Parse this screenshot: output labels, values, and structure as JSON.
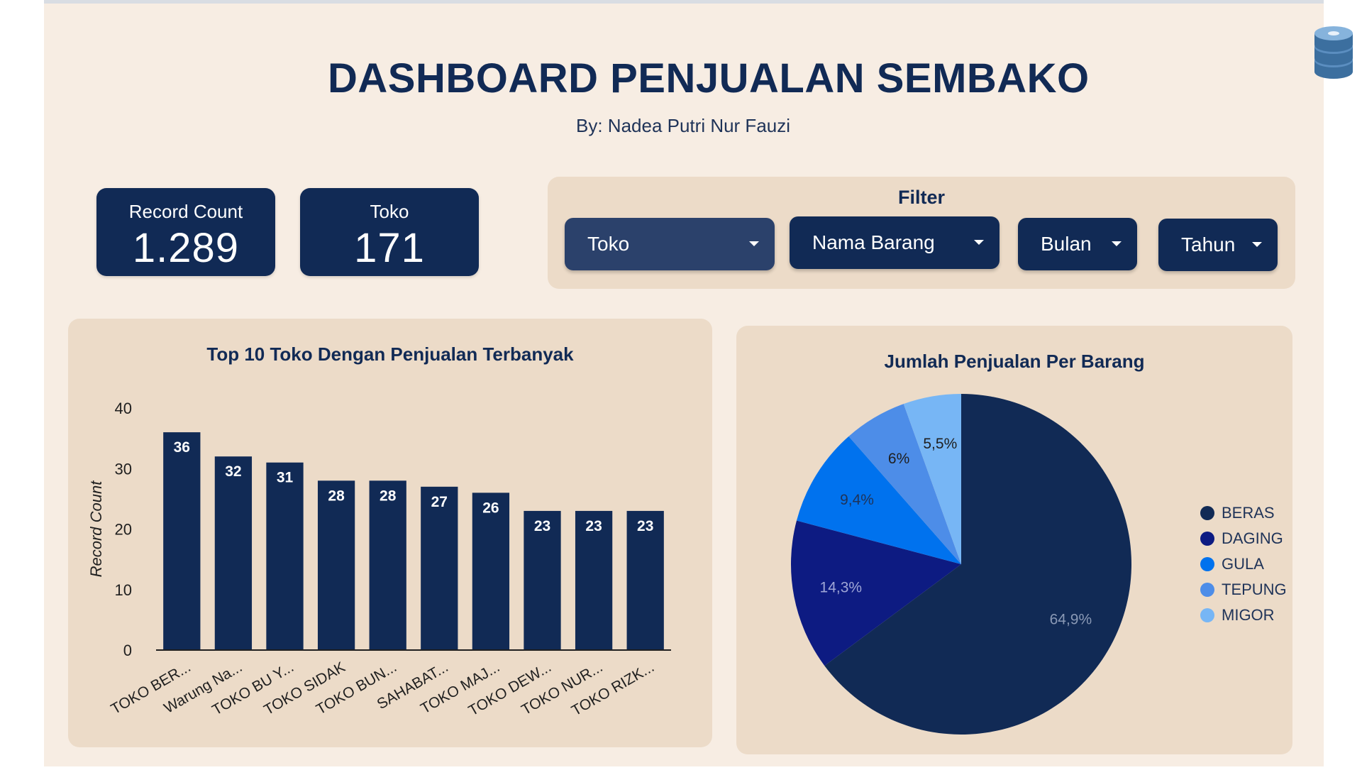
{
  "header": {
    "title": "DASHBOARD PENJUALAN SEMBAKO",
    "subtitle": "By: Nadea Putri Nur Fauzi"
  },
  "icons": {
    "data_source": "database-icon"
  },
  "kpis": [
    {
      "label": "Record Count",
      "value": "1.289"
    },
    {
      "label": "Toko",
      "value": "171"
    }
  ],
  "filter": {
    "title": "Filter",
    "dropdowns": [
      {
        "label": "Toko",
        "selected": true
      },
      {
        "label": "Nama Barang",
        "selected": false
      },
      {
        "label": "Bulan",
        "selected": false
      },
      {
        "label": "Tahun",
        "selected": false
      }
    ]
  },
  "colors": {
    "primary": "#112a55",
    "background": "#f7ede3",
    "panel": "#ecdbc8",
    "selected_dropdown": "#2b416b"
  },
  "chart_data": [
    {
      "type": "bar",
      "title": "Top 10 Toko Dengan Penjualan Terbanyak",
      "ylabel": "Record Count",
      "xlabel": "",
      "ylim": [
        0,
        40
      ],
      "yticks": [
        0,
        10,
        20,
        30,
        40
      ],
      "categories": [
        "TOKO BER...",
        "Warung Na...",
        "TOKO BU Y...",
        "TOKO SIDAK",
        "TOKO BUN...",
        "SAHABAT...",
        "TOKO MAJ...",
        "TOKO DEW...",
        "TOKO NUR...",
        "TOKO RIZK..."
      ],
      "values": [
        36,
        32,
        31,
        28,
        28,
        27,
        26,
        23,
        23,
        23
      ],
      "color": "#112a55",
      "grid": false,
      "data_labels": true
    },
    {
      "type": "pie",
      "title": "Jumlah Penjualan Per Barang",
      "categories": [
        "BERAS",
        "DAGING",
        "GULA",
        "TEPUNG",
        "MIGOR"
      ],
      "values": [
        64.9,
        14.3,
        9.4,
        6,
        5.5
      ],
      "labels": [
        "64,9%",
        "14,3%",
        "9,4%",
        "6%",
        "5,5%"
      ],
      "colors": [
        "#112a55",
        "#0d1b82",
        "#0072ee",
        "#4d8de8",
        "#77b6f5"
      ],
      "legend": "right"
    }
  ]
}
